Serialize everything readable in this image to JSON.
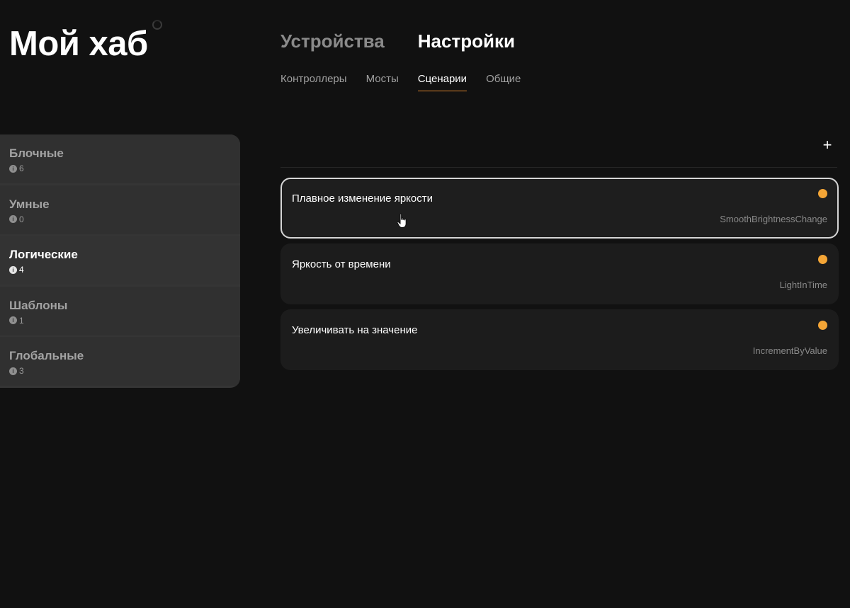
{
  "app": {
    "title": "Мой хаб"
  },
  "main_tabs": [
    {
      "label": "Устройства",
      "active": false
    },
    {
      "label": "Настройки",
      "active": true
    }
  ],
  "sub_tabs": [
    {
      "label": "Контроллеры",
      "active": false
    },
    {
      "label": "Мосты",
      "active": false
    },
    {
      "label": "Сценарии",
      "active": true
    },
    {
      "label": "Общие",
      "active": false
    }
  ],
  "categories": [
    {
      "label": "Блочные",
      "count": "6",
      "active": false
    },
    {
      "label": "Умные",
      "count": "0",
      "active": false
    },
    {
      "label": "Логические",
      "count": "4",
      "active": true
    },
    {
      "label": "Шаблоны",
      "count": "1",
      "active": false
    },
    {
      "label": "Глобальные",
      "count": "3",
      "active": false
    }
  ],
  "toolbar": {
    "add_label": "+"
  },
  "scenarios": [
    {
      "title": "Плавное изменение яркости",
      "id": "SmoothBrightnessChange",
      "selected": true
    },
    {
      "title": "Яркость от времени",
      "id": "LightInTime",
      "selected": false
    },
    {
      "title": "Увеличивать на значение",
      "id": "IncrementByValue",
      "selected": false
    }
  ],
  "icons": {
    "info": "info-icon",
    "status": "status-dot",
    "add": "plus-icon",
    "cursor": "hand-pointer-icon"
  },
  "colors": {
    "accent": "#d9822b",
    "status": "#f4a536",
    "background": "#111111",
    "panel": "#353535"
  }
}
